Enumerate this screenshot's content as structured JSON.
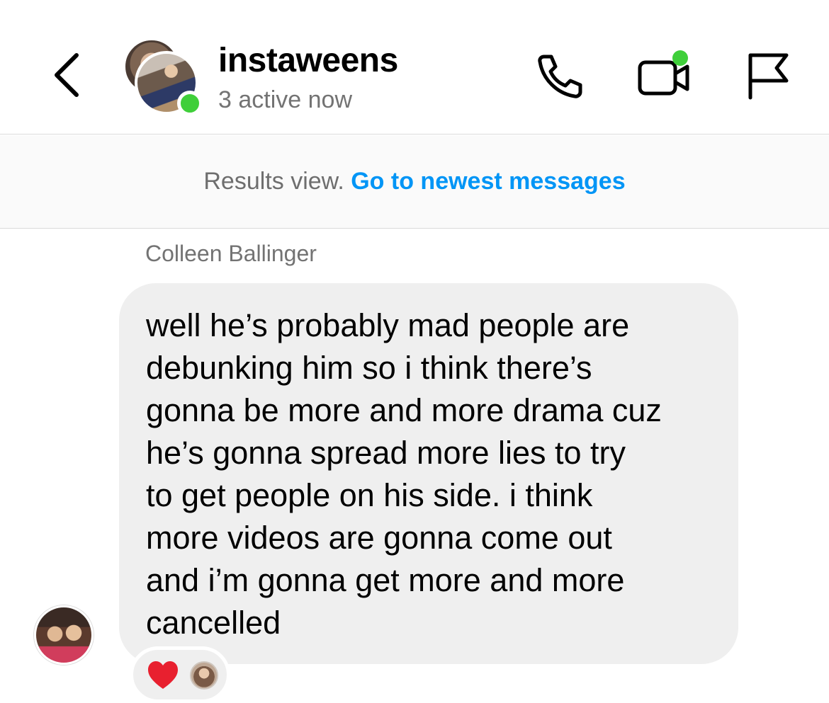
{
  "header": {
    "back_icon": "chevron-left-icon",
    "title": "instaweens",
    "subtitle": "3 active now",
    "icons": [
      "phone-icon",
      "video-camera-icon",
      "flag-icon"
    ],
    "online_color": "#3fcf3a"
  },
  "results_bar": {
    "label": "Results view.",
    "link": "Go to newest messages",
    "link_color": "#0095f6"
  },
  "message": {
    "sender": "Colleen Ballinger",
    "text": "well he’s probably mad people are\ndebunking him so i think there’s\ngonna be more and more drama cuz\nhe’s gonna spread more lies to try\nto get people on his side. i think\nmore videos  are gonna come out\nand i’m gonna get more and more\ncancelled",
    "reaction": "heart-icon"
  }
}
